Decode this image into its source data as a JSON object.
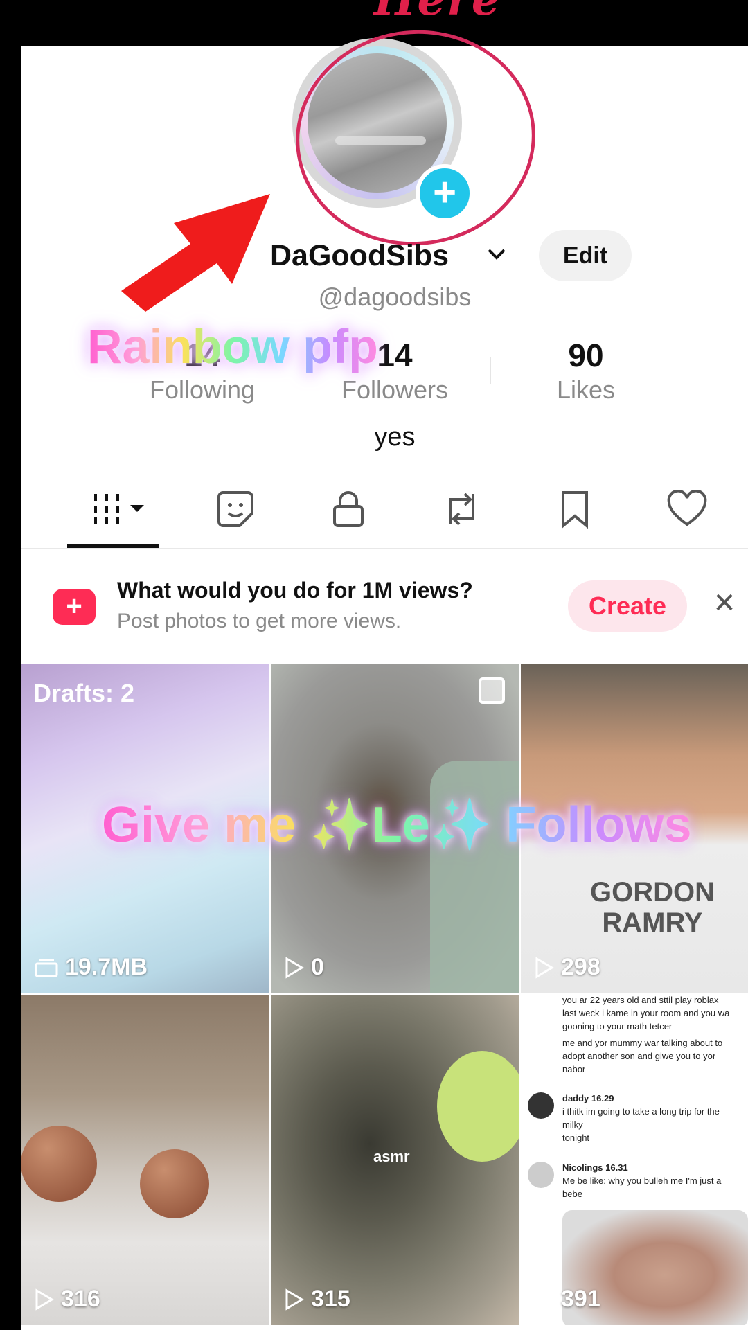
{
  "annotation": {
    "top_text": "Here",
    "pfp_label": "Rainbow pfp",
    "follows_text": "Give me ✨Le✨ Follows"
  },
  "profile": {
    "username": "DaGoodSibs",
    "handle": "@dagoodsibs",
    "edit_label": "Edit",
    "bio": "yes",
    "stats": [
      {
        "value": "14",
        "label": "Following"
      },
      {
        "value": "14",
        "label": "Followers"
      },
      {
        "value": "90",
        "label": "Likes"
      }
    ]
  },
  "tabs": [
    "videos-grid",
    "sticker",
    "lock",
    "repost",
    "bookmark",
    "heart"
  ],
  "banner": {
    "title": "What would you do for 1M views?",
    "subtitle": "Post photos to get more views.",
    "create_label": "Create"
  },
  "grid": [
    {
      "kind": "drafts",
      "label": "Drafts: 2",
      "count": "19.7MB"
    },
    {
      "kind": "video",
      "count": "0"
    },
    {
      "kind": "video",
      "count": "298",
      "shirt": "GORDON RAMRY"
    },
    {
      "kind": "video",
      "count": "316"
    },
    {
      "kind": "video",
      "count": "315",
      "overlay": "asmr"
    },
    {
      "kind": "video",
      "count": "391",
      "chat": [
        "you ar 22 years old and sttil play roblax",
        "last weck i kame in your room and you wa",
        "gooning to your math tetcer",
        "me and yor mummy war talking about to",
        "adopt another son and giwe you to yor",
        "nabor",
        "daddy 16.29",
        "i thitk im going to take a long trip for the",
        "milky",
        "tonight",
        "Nicolings 16.31",
        "Me be like: why you bulleh me I'm just a",
        "bebe"
      ]
    }
  ]
}
